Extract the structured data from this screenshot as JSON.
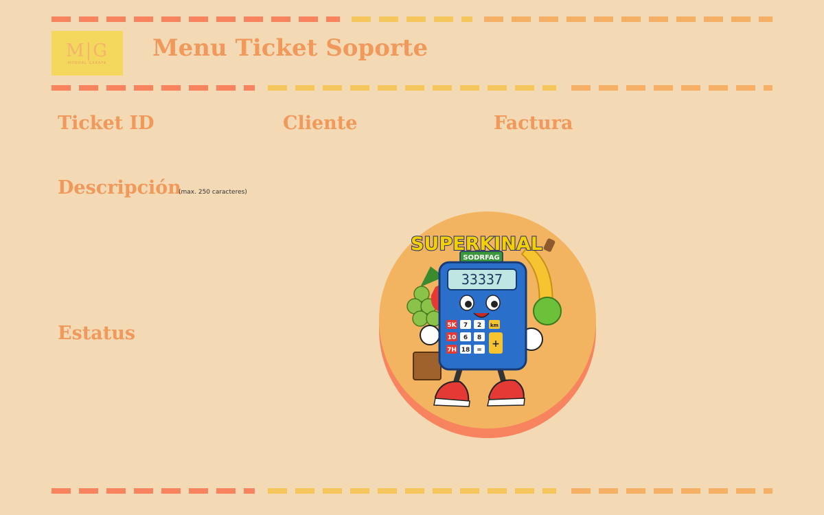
{
  "header": {
    "logo_mark": "M|G",
    "logo_subtitle": "MONDAL GARAFA",
    "title": "Menu Ticket Soporte"
  },
  "fields": {
    "ticket_id_label": "Ticket ID",
    "cliente_label": "Cliente",
    "factura_label": "Factura",
    "descripcion_label": "Descripción",
    "descripcion_note": "(max. 250 caracteres)",
    "estatus_label": "Estatus"
  },
  "mascot": {
    "brand": "SUPERKINAL",
    "sub": "SODRFAG",
    "display": "33337",
    "keys": [
      "5K",
      "7",
      "2",
      "km",
      "10",
      "6",
      "8",
      "7H",
      "18",
      "="
    ],
    "plus": "+"
  },
  "colors": {
    "background": "#f4d9b5",
    "accent_orange": "#f0995a",
    "dash_coral": "#f7845e",
    "dash_yellow": "#f5c65c",
    "dash_light_orange": "#f5b065"
  }
}
